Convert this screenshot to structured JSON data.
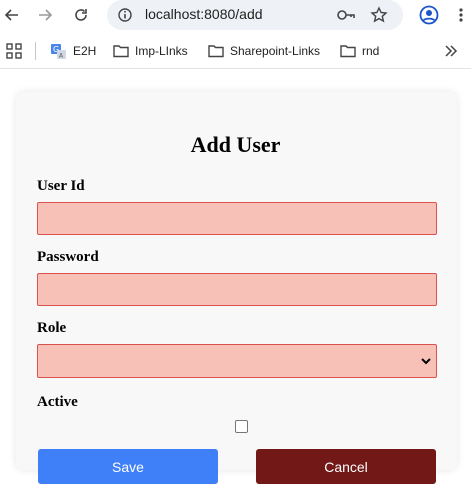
{
  "browser": {
    "url": "localhost:8080/add"
  },
  "bookmarks": [
    {
      "label": "E2H",
      "icon": "translate-icon"
    },
    {
      "label": "Imp-LInks",
      "icon": "folder-icon"
    },
    {
      "label": "Sharepoint-Links",
      "icon": "folder-icon"
    },
    {
      "label": "rnd",
      "icon": "folder-icon"
    }
  ],
  "form": {
    "title": "Add User",
    "user_id_label": "User Id",
    "user_id_value": "",
    "password_label": "Password",
    "password_value": "",
    "role_label": "Role",
    "role_selected": "",
    "active_label": "Active",
    "active_checked": false,
    "save_label": "Save",
    "cancel_label": "Cancel"
  },
  "colors": {
    "field_bg": "#f8c1b8",
    "field_border": "#d9534f",
    "save_bg": "#3f7ff7",
    "cancel_bg": "#721817"
  }
}
